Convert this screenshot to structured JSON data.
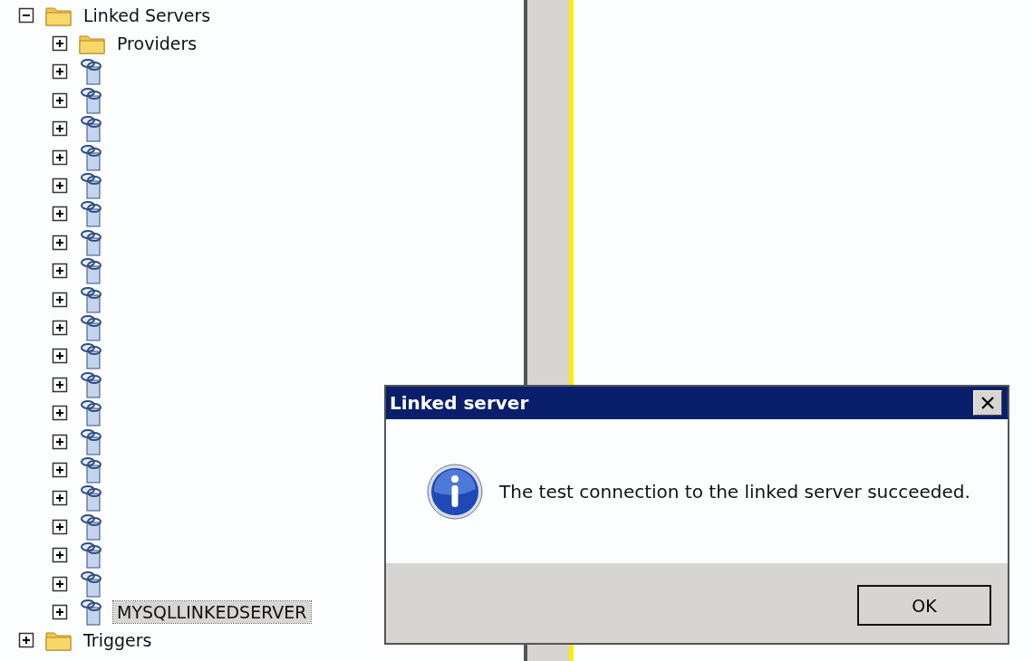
{
  "tree": [
    {
      "kind": "folder",
      "label": "Linked Servers",
      "expanded": true,
      "selected": false,
      "children": [
        {
          "kind": "folder",
          "label": "Providers",
          "expanded": false,
          "selected": false
        },
        {
          "kind": "server",
          "expanded": false,
          "selected": false
        },
        {
          "kind": "server",
          "expanded": false,
          "selected": false
        },
        {
          "kind": "server",
          "expanded": false,
          "selected": false
        },
        {
          "kind": "server",
          "expanded": false,
          "selected": false
        },
        {
          "kind": "server",
          "expanded": false,
          "selected": false
        },
        {
          "kind": "server",
          "expanded": false,
          "selected": false
        },
        {
          "kind": "server",
          "expanded": false,
          "selected": false
        },
        {
          "kind": "server",
          "expanded": false,
          "selected": false
        },
        {
          "kind": "server",
          "expanded": false,
          "selected": false
        },
        {
          "kind": "server",
          "expanded": false,
          "selected": false
        },
        {
          "kind": "server",
          "expanded": false,
          "selected": false
        },
        {
          "kind": "server",
          "expanded": false,
          "selected": false
        },
        {
          "kind": "server",
          "expanded": false,
          "selected": false
        },
        {
          "kind": "server",
          "expanded": false,
          "selected": false
        },
        {
          "kind": "server",
          "expanded": false,
          "selected": false
        },
        {
          "kind": "server",
          "expanded": false,
          "selected": false
        },
        {
          "kind": "server",
          "expanded": false,
          "selected": false
        },
        {
          "kind": "server",
          "expanded": false,
          "selected": false
        },
        {
          "kind": "server",
          "expanded": false,
          "selected": false
        },
        {
          "kind": "server",
          "label": "MYSQLLINKEDSERVER",
          "expanded": false,
          "selected": true
        }
      ]
    },
    {
      "kind": "folder",
      "label": "Triggers",
      "expanded": false,
      "selected": false
    }
  ],
  "dialog": {
    "title": "Linked server",
    "message": "The test connection to the linked server succeeded.",
    "buttons": [
      "OK"
    ]
  }
}
